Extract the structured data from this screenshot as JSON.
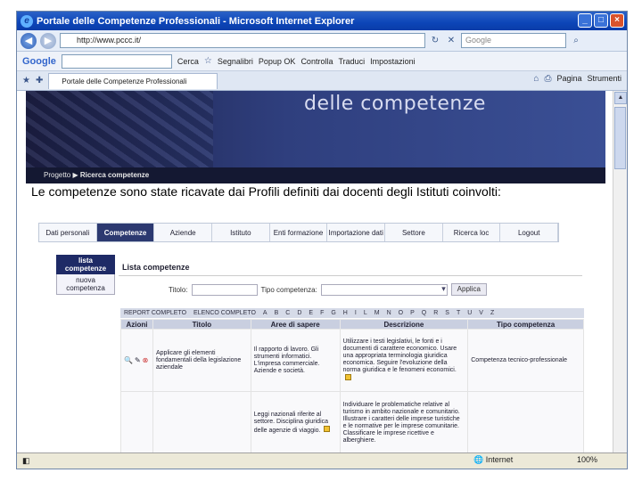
{
  "window": {
    "title": "Portale delle Competenze Professionali - Microsoft Internet Explorer",
    "controls": [
      "_",
      "□",
      "×"
    ]
  },
  "address_bar": {
    "url": "http://www.pccc.it/",
    "search_placeholder": "Google"
  },
  "toolbar": {
    "google_label": "Google",
    "go_label": "Cerca",
    "items": [
      "Segnalibri",
      "Popup OK",
      "Controlla",
      "Traduci",
      "Impostazioni"
    ]
  },
  "tabs": {
    "active_tab": "Portale delle Competenze Professionali",
    "tools": [
      "Pagina",
      "Strumenti"
    ]
  },
  "page": {
    "banner_title": "delle competenze",
    "breadcrumb": [
      "Progetto",
      "Ricerca competenze"
    ],
    "caption": "Le competenze sono state ricavate dai Profili definiti dai docenti degli Istituti coinvolti:",
    "menu": [
      "Dati personali",
      "Competenze",
      "Aziende",
      "Istituto",
      "Enti formazione",
      "Importazione dati",
      "Settore",
      "Ricerca loc",
      "Logout"
    ],
    "menu_active_index": 1,
    "side_menu": [
      "lista competenze",
      "nuova competenza"
    ],
    "panel_title": "Lista competenze",
    "filters": {
      "title_label": "Titolo:",
      "type_label": "Tipo competenza:",
      "apply_label": "Applica"
    },
    "alpha_bar": [
      "REPORT COMPLETO",
      "ELENCO COMPLETO",
      "A",
      "B",
      "C",
      "D",
      "E",
      "F",
      "G",
      "H",
      "I",
      "L",
      "M",
      "N",
      "O",
      "P",
      "Q",
      "R",
      "S",
      "T",
      "U",
      "V",
      "Z"
    ],
    "table": {
      "headers": [
        "Azioni",
        "Titolo",
        "Aree di sapere",
        "Descrizione",
        "Tipo competenza"
      ],
      "rows": [
        {
          "title": "Applicare gli elementi fondamentali della legislazione aziendale",
          "areas": "Il rapporto di lavoro. Gli strumenti informatici. L'impresa commerciale. Aziende e società.",
          "description": "Utilizzare i testi legislativi, le fonti e i documenti di carattere economico. Usare una appropriata terminologia giuridica economica. Seguire l'evoluzione della norma giuridica e le fenomeni economici.",
          "type": "Competenza tecnico-professionale"
        },
        {
          "title": "",
          "areas": "Leggi nazionali riferite al settore. Disciplina giuridica delle agenzie di viaggio.",
          "description": "Individuare le problematiche relative al turismo in ambito nazionale e comunitario. Illustrare i caratteri delle imprese turistiche e le normative per le imprese comunitarie. Classificare le imprese ricettive e alberghiere.",
          "type": ""
        }
      ]
    }
  },
  "status_bar": {
    "zone": "Internet",
    "zoom": "100%"
  }
}
